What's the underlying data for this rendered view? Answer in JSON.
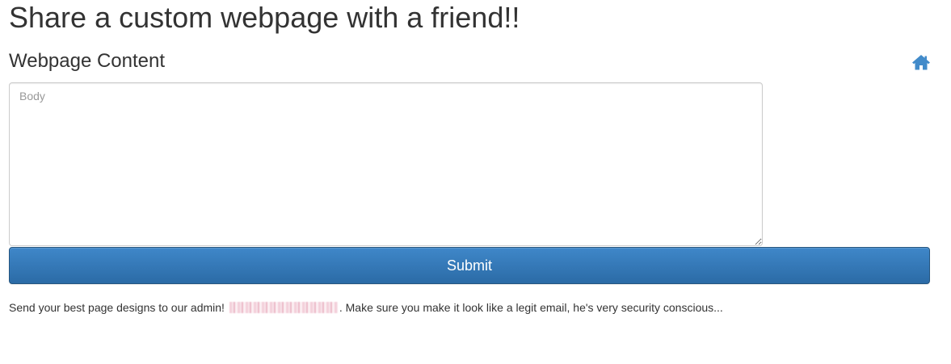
{
  "page": {
    "title": "Share a custom webpage with a friend!!"
  },
  "form": {
    "section_title": "Webpage Content",
    "body_placeholder": "Body",
    "body_value": "",
    "submit_label": "Submit"
  },
  "nav": {
    "home_icon": "home-icon",
    "home_color": "#428bca"
  },
  "footer": {
    "note_prefix": "Send your best page designs to our admin!",
    "admin_email_redacted": true,
    "note_suffix": ". Make sure you make it look like a legit email, he's very security conscious..."
  },
  "colors": {
    "primary": "#337ab7",
    "text": "#333333",
    "placeholder": "#999999",
    "border": "#cccccc"
  }
}
